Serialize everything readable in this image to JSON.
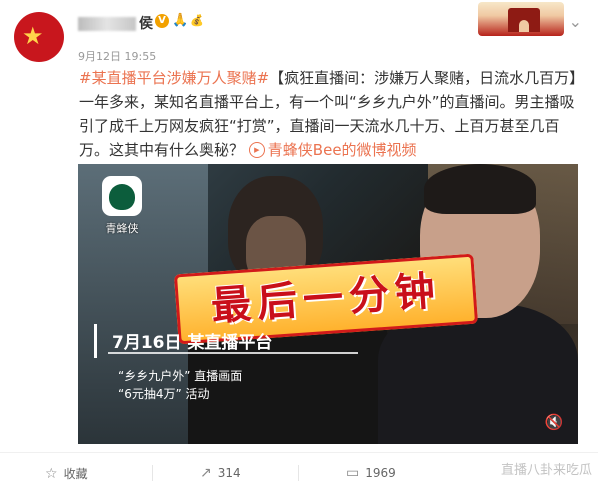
{
  "post": {
    "username_visible": "侯",
    "emoji": "🙏",
    "vip_mark": "💰",
    "date": "9月12日",
    "time": "19:55",
    "topic": "#某直播平台涉嫌万人聚赌#",
    "body_part1": "【疯狂直播间：涉嫌万人聚赌，日流水几百万】一年多来，某知名直播平台上，有一个叫“乡乡九户外”的直播间。男主播吸引了成千上万网友疯狂“打赏”，直播间一天流水几十万、上百万甚至几百万。这其中有什么奥秘？",
    "video_link": "青蜂侠Bee的微博视频"
  },
  "video": {
    "app_name": "青蜂侠",
    "big_caption": "最后一分钟",
    "date_caption": "7月16日  某直播平台",
    "sub1": "“乡乡九户外” 直播画面",
    "sub2": "“6元抽4万” 活动"
  },
  "actions": {
    "favorite": "收藏",
    "repost": "314",
    "comment": "1969"
  },
  "watermark": "直播八卦来吃瓜",
  "colors": {
    "link": "#eb7350",
    "accent_red": "#c90f1a"
  },
  "icons": {
    "favorite": "star-icon",
    "repost": "repost-icon",
    "comment": "comment-icon",
    "more": "chevron-down-icon",
    "volume": "volume-icon"
  }
}
